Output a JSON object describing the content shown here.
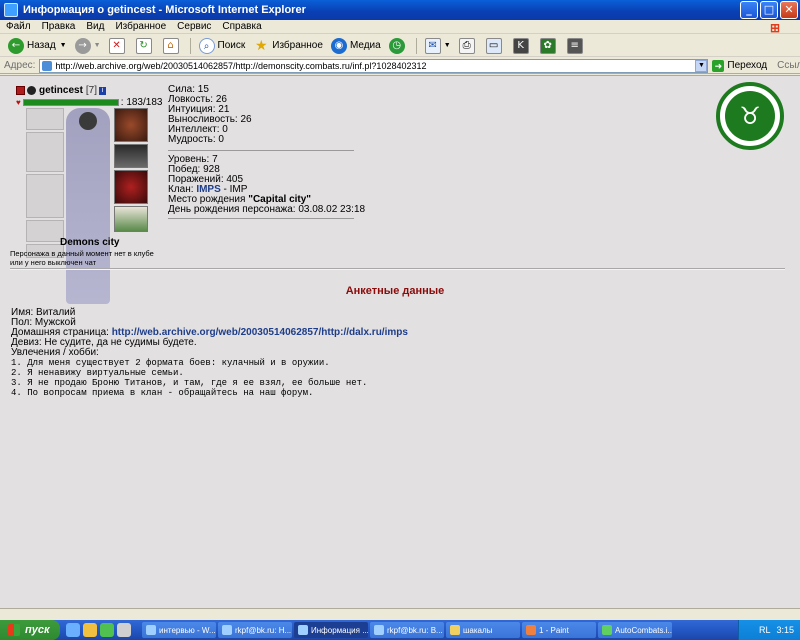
{
  "window": {
    "title": "Информация о getincest - Microsoft Internet Explorer"
  },
  "menu": [
    "Файл",
    "Правка",
    "Вид",
    "Избранное",
    "Сервис",
    "Справка"
  ],
  "toolbar": {
    "back": "Назад",
    "search": "Поиск",
    "favorites": "Избранное",
    "media": "Медиа"
  },
  "address": {
    "label": "Адрес:",
    "url": "http://web.archive.org/web/20030514062857/http://demonscity.combats.ru/inf.pl?1028402312",
    "go": "Переход",
    "links": "Ссылки"
  },
  "character": {
    "name": "getincest",
    "level": "[7]",
    "hp": "183/183",
    "hp_fraction": 1.0,
    "city": "Demons city",
    "offline_note_1": "Персонажа в данный момент нет в клубе",
    "offline_note_2": "или у него выключен чат"
  },
  "stats": [
    "Сила: 15",
    "Ловкость: 26",
    "Интуиция: 21",
    "Выносливость: 26",
    "Интеллект: 0",
    "Мудрость: 0"
  ],
  "info": {
    "level": "Уровень: 7",
    "wins": "Побед: 928",
    "losses": "Поражений: 405",
    "clan_label": "Клан: ",
    "clan_name": "IMPS",
    "clan_suffix": " - IMP",
    "birthplace_label": "Место рождения ",
    "birthplace": "\"Capital city\"",
    "birthday": "День рождения персонажа: 03.08.02 23:18"
  },
  "profile": {
    "section_title": "Анкетные данные",
    "name": "Имя: Виталий",
    "sex": "Пол: Мужской",
    "homepage_label": "Домашняя страница: ",
    "homepage": "http://web.archive.org/web/20030514062857/http://dalx.ru/imps",
    "motto": "Девиз: Не судите, да не судимы будете.",
    "hobbies_label": "Увлечения / хобби:",
    "hobbies": [
      "1. Для меня существует 2 формата боев: кулачный и в оружии.",
      "2. Я ненавижу виртуальные семьи.",
      "3. Я не продаю Броню Титанов, и там, где я ее взял, ее больше нет.",
      "4. По вопросам приема в клан - обращайтесь на наш форум."
    ]
  },
  "taskbar": {
    "start": "пуск",
    "tasks": [
      "интервью - W...",
      "rkpf@bk.ru: Н...",
      "Информация ...",
      "rkpf@bk.ru: В...",
      "шакалы",
      "1 - Paint",
      "AutoCombats.i..."
    ],
    "lang": "RL",
    "clock": "3:15"
  },
  "colors": {
    "clan_green": "#1e7a1e",
    "section_red": "#8b0a0a",
    "hp_green": "#1d8a1d"
  }
}
